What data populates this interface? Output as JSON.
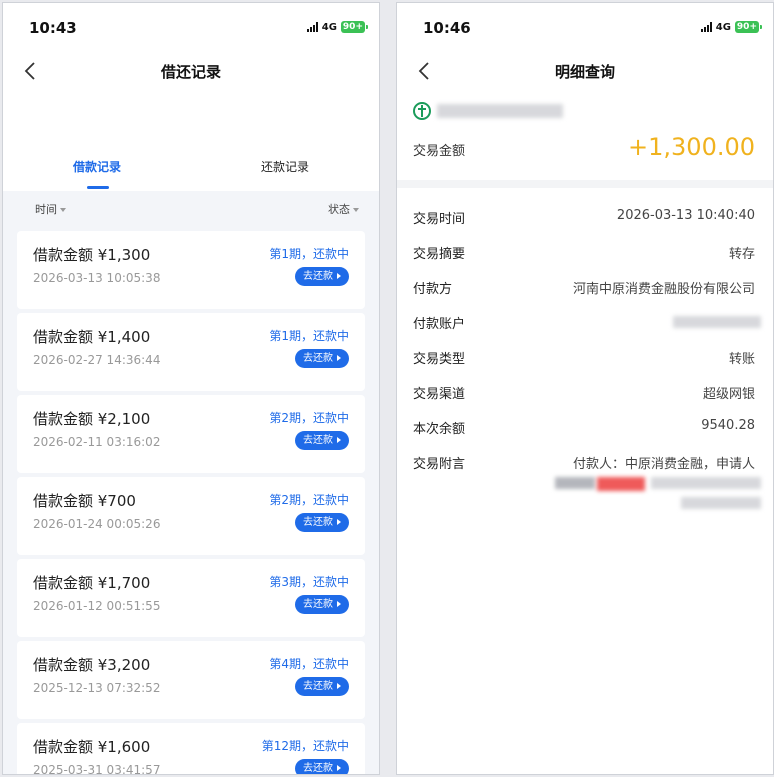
{
  "left": {
    "status": {
      "time": "10:43",
      "network": "4G",
      "battery": "90+"
    },
    "nav": {
      "title": "借还记录"
    },
    "tabs": [
      {
        "label": "借款记录"
      },
      {
        "label": "还款记录"
      }
    ],
    "filters": {
      "time": "时间",
      "status": "状态"
    },
    "records": [
      {
        "amount": "借款金额 ¥1,300",
        "date": "2026-03-13 10:05:38",
        "period": "第1期，还款中",
        "button": "去还款"
      },
      {
        "amount": "借款金额 ¥1,400",
        "date": "2026-02-27 14:36:44",
        "period": "第1期，还款中",
        "button": "去还款"
      },
      {
        "amount": "借款金额 ¥2,100",
        "date": "2026-02-11 03:16:02",
        "period": "第2期，还款中",
        "button": "去还款"
      },
      {
        "amount": "借款金额 ¥700",
        "date": "2026-01-24 00:05:26",
        "period": "第2期，还款中",
        "button": "去还款"
      },
      {
        "amount": "借款金额 ¥1,700",
        "date": "2026-01-12 00:51:55",
        "period": "第3期，还款中",
        "button": "去还款"
      },
      {
        "amount": "借款金额 ¥3,200",
        "date": "2025-12-13 07:32:52",
        "period": "第4期，还款中",
        "button": "去还款"
      },
      {
        "amount": "借款金额 ¥1,600",
        "date": "2025-03-31 03:41:57",
        "period": "第12期，还款中",
        "button": "去还款"
      }
    ]
  },
  "right": {
    "status": {
      "time": "10:46",
      "network": "4G",
      "battery": "90+"
    },
    "nav": {
      "title": "明细查询"
    },
    "amount_label": "交易金额",
    "amount_value": "+1,300.00",
    "details": [
      {
        "label": "交易时间",
        "value": "2026-03-13 10:40:40"
      },
      {
        "label": "交易摘要",
        "value": "转存"
      },
      {
        "label": "付款方",
        "value": "河南中原消费金融股份有限公司"
      },
      {
        "label": "付款账户",
        "value": ""
      },
      {
        "label": "交易类型",
        "value": "转账"
      },
      {
        "label": "交易渠道",
        "value": "超级网银"
      },
      {
        "label": "本次余额",
        "value": "9540.28"
      },
      {
        "label": "交易附言",
        "value": "付款人：中原消费金融，申请人"
      }
    ]
  },
  "colors": {
    "accent": "#1f6be8",
    "amount": "#f0b21e",
    "battery": "#3bc155"
  }
}
